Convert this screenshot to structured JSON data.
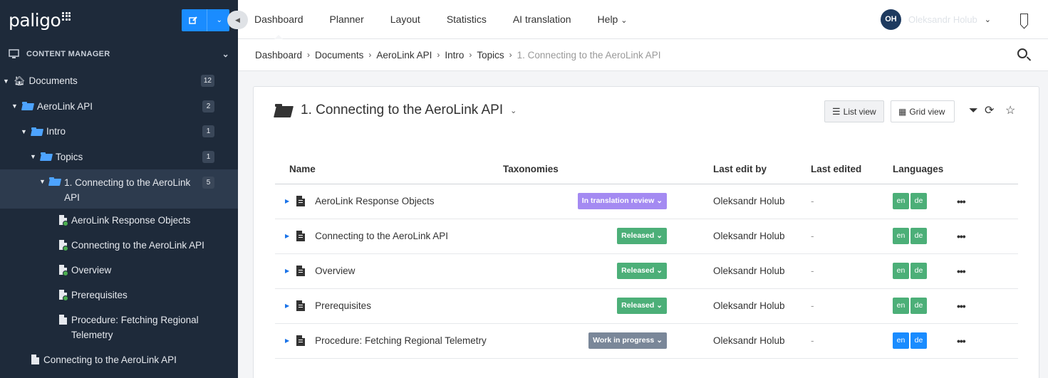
{
  "sidebar": {
    "logo": "paligo",
    "section_title": "CONTENT MANAGER",
    "tree": [
      {
        "label": "Documents",
        "count": "12"
      },
      {
        "label": "AeroLink API",
        "count": "2"
      },
      {
        "label": "Intro",
        "count": "1"
      },
      {
        "label": "Topics",
        "count": "1"
      },
      {
        "label": "1. Connecting to the AeroLink API",
        "count": "5"
      }
    ],
    "docs": [
      "AeroLink Response Objects",
      "Connecting to the AeroLink API",
      "Overview",
      "Prerequisites",
      "Procedure: Fetching Regional Telemetry"
    ],
    "bottom_doc": "Connecting to the AeroLink API"
  },
  "nav": {
    "items": [
      "Dashboard",
      "Planner",
      "Layout",
      "Statistics",
      "AI translation",
      "Help"
    ],
    "user_initials": "OH",
    "user_name": "Oleksandr Holub"
  },
  "breadcrumb": [
    "Dashboard",
    "Documents",
    "AeroLink API",
    "Intro",
    "Topics",
    "1. Connecting to the AeroLink API"
  ],
  "panel": {
    "title": "1. Connecting to the AeroLink API",
    "list_view": "List view",
    "grid_view": "Grid view",
    "columns": [
      "Name",
      "Taxonomies",
      "Last edit by",
      "Last edited",
      "Languages"
    ],
    "rows": [
      {
        "name": "AeroLink Response Objects",
        "status": "In translation review",
        "status_color": "#a48af2",
        "editor": "Oleksandr Holub",
        "edited": "-",
        "langs": [
          "en",
          "de"
        ],
        "lang_color": "#4caf78"
      },
      {
        "name": "Connecting to the AeroLink API",
        "status": "Released",
        "status_color": "#4caf78",
        "editor": "Oleksandr Holub",
        "edited": "-",
        "langs": [
          "en",
          "de"
        ],
        "lang_color": "#4caf78"
      },
      {
        "name": "Overview",
        "status": "Released",
        "status_color": "#4caf78",
        "editor": "Oleksandr Holub",
        "edited": "-",
        "langs": [
          "en",
          "de"
        ],
        "lang_color": "#4caf78"
      },
      {
        "name": "Prerequisites",
        "status": "Released",
        "status_color": "#4caf78",
        "editor": "Oleksandr Holub",
        "edited": "-",
        "langs": [
          "en",
          "de"
        ],
        "lang_color": "#4caf78"
      },
      {
        "name": "Procedure: Fetching Regional Telemetry",
        "status": "Work in progress",
        "status_color": "#7a8799",
        "editor": "Oleksandr Holub",
        "edited": "-",
        "langs": [
          "en",
          "de"
        ],
        "lang_color": "#1a8cff"
      }
    ]
  },
  "colors": {
    "sidebar_bg": "#1e2a3a",
    "accent": "#1a8cff",
    "released": "#4caf78",
    "review": "#a48af2",
    "wip": "#7a8799"
  }
}
